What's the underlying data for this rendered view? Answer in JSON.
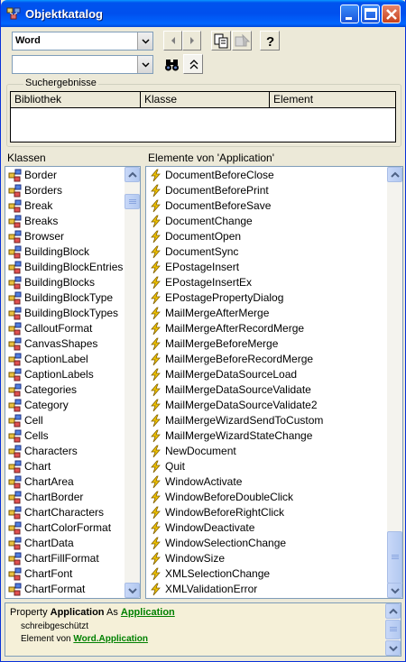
{
  "window": {
    "title": "Objektkatalog",
    "colors": {
      "titlebar": "#0054e3",
      "face": "#ece9d8",
      "link": "#008000",
      "member_icon": "#f2c500"
    }
  },
  "toolbar": {
    "library_combo_value": "Word",
    "search_combo_value": ""
  },
  "search_results": {
    "group_label": "Suchergebnisse",
    "columns": [
      "Bibliothek",
      "Klasse",
      "Element"
    ]
  },
  "classes": {
    "header": "Klassen",
    "items": [
      "Border",
      "Borders",
      "Break",
      "Breaks",
      "Browser",
      "BuildingBlock",
      "BuildingBlockEntries",
      "BuildingBlocks",
      "BuildingBlockType",
      "BuildingBlockTypes",
      "CalloutFormat",
      "CanvasShapes",
      "CaptionLabel",
      "CaptionLabels",
      "Categories",
      "Category",
      "Cell",
      "Cells",
      "Characters",
      "Chart",
      "ChartArea",
      "ChartBorder",
      "ChartCharacters",
      "ChartColorFormat",
      "ChartData",
      "ChartFillFormat",
      "ChartFont",
      "ChartFormat"
    ]
  },
  "members": {
    "header": "Elemente von 'Application'",
    "items": [
      "DocumentBeforeClose",
      "DocumentBeforePrint",
      "DocumentBeforeSave",
      "DocumentChange",
      "DocumentOpen",
      "DocumentSync",
      "EPostageInsert",
      "EPostageInsertEx",
      "EPostagePropertyDialog",
      "MailMergeAfterMerge",
      "MailMergeAfterRecordMerge",
      "MailMergeBeforeMerge",
      "MailMergeBeforeRecordMerge",
      "MailMergeDataSourceLoad",
      "MailMergeDataSourceValidate",
      "MailMergeDataSourceValidate2",
      "MailMergeWizardSendToCustom",
      "MailMergeWizardStateChange",
      "NewDocument",
      "Quit",
      "WindowActivate",
      "WindowBeforeDoubleClick",
      "WindowBeforeRightClick",
      "WindowDeactivate",
      "WindowSelectionChange",
      "WindowSize",
      "XMLSelectionChange",
      "XMLValidationError"
    ]
  },
  "details": {
    "prefix": "Property ",
    "name": "Application",
    "as": " As ",
    "type_link": "Application",
    "readonly": "schreibgeschützt",
    "member_of": "Element von ",
    "member_of_link": "Word.Application"
  }
}
